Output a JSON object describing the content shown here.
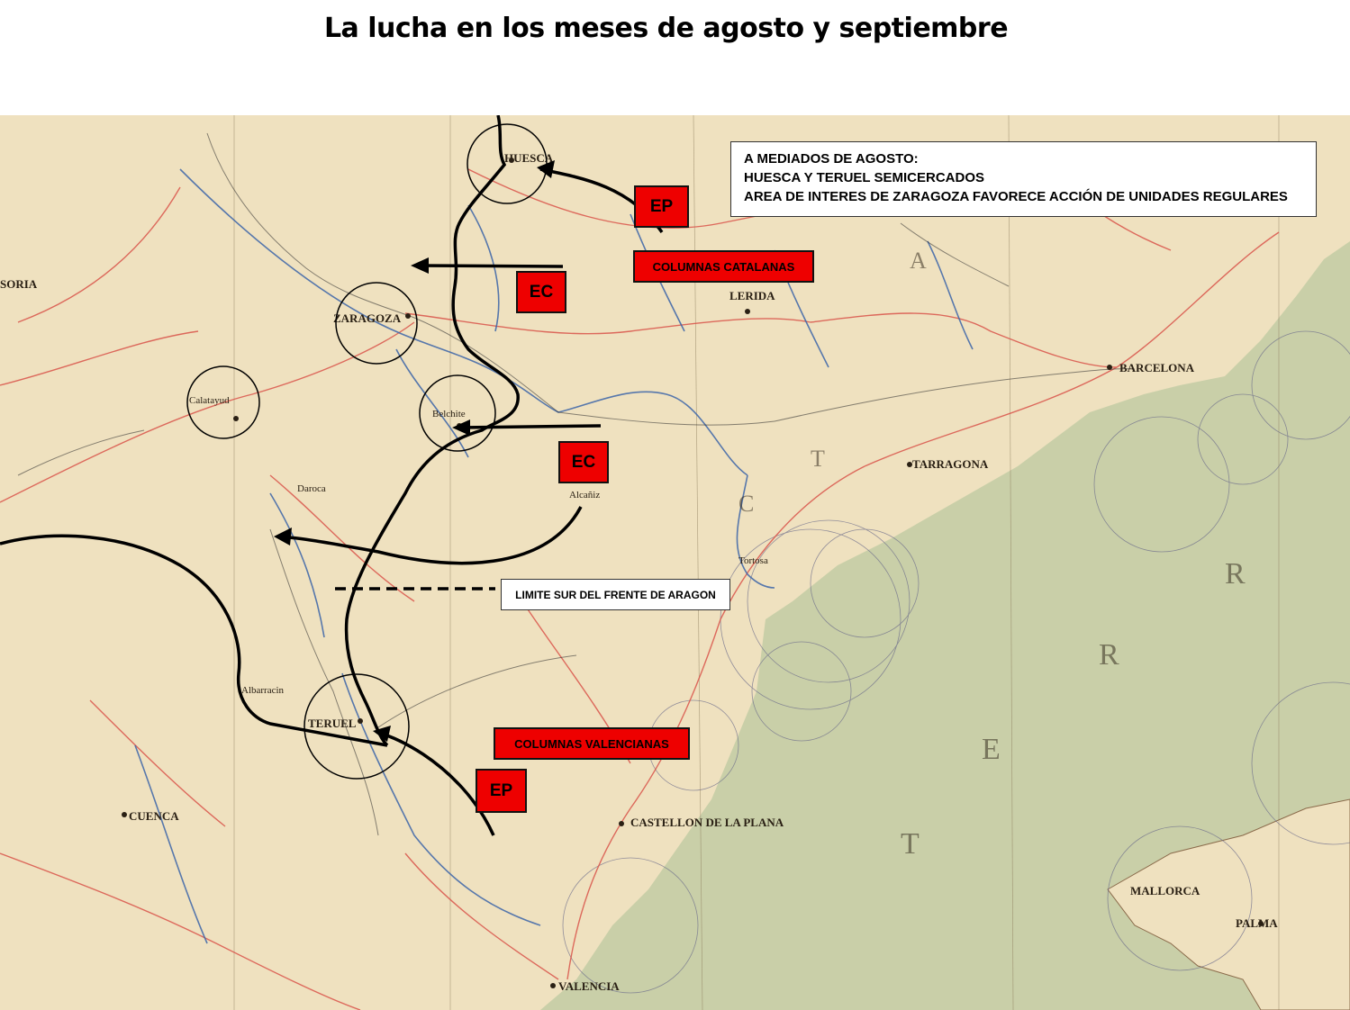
{
  "title": "La lucha en los meses de agosto y septiembre",
  "info_box": {
    "line1": "A MEDIADOS DE AGOSTO:",
    "line2": "HUESCA Y TERUEL SEMICERCADOS",
    "line3": "AREA DE INTERES DE ZARAGOZA FAVORECE ACCIÓN DE UNIDADES REGULARES"
  },
  "labels": {
    "ep_north": "EP",
    "ec_north": "EC",
    "ec_mid": "EC",
    "ep_south": "EP",
    "columnas_catalanas": "COLUMNAS CATALANAS",
    "columnas_valencianas": "COLUMNAS VALENCIANAS",
    "limite_sur": "LIMITE SUR DEL FRENTE DE ARAGON"
  },
  "places": {
    "huesca": "HUESCA",
    "zaragoza": "ZARAGOZA",
    "lerida": "LERIDA",
    "barcelona": "BARCELONA",
    "tarragona": "TARRAGONA",
    "teruel": "TERUEL",
    "cuenca": "CUENCA",
    "castellon": "CASTELLON DE LA PLANA",
    "valencia": "VALENCIA",
    "mallorca": "MALLORCA",
    "palma": "PALMA",
    "soria": "SORIA",
    "belchite": "Belchite",
    "calatayud": "Calatayud",
    "albarracin": "Albarracin",
    "daroca": "Daroca",
    "alcaniz": "Alcañiz",
    "tortosa": "Tortosa"
  },
  "colors": {
    "land": "#efe1bf",
    "sea": "#c9cfa8",
    "roads": "#d9544a",
    "rivers": "#3b64a8",
    "label_box": "#ee0000"
  }
}
